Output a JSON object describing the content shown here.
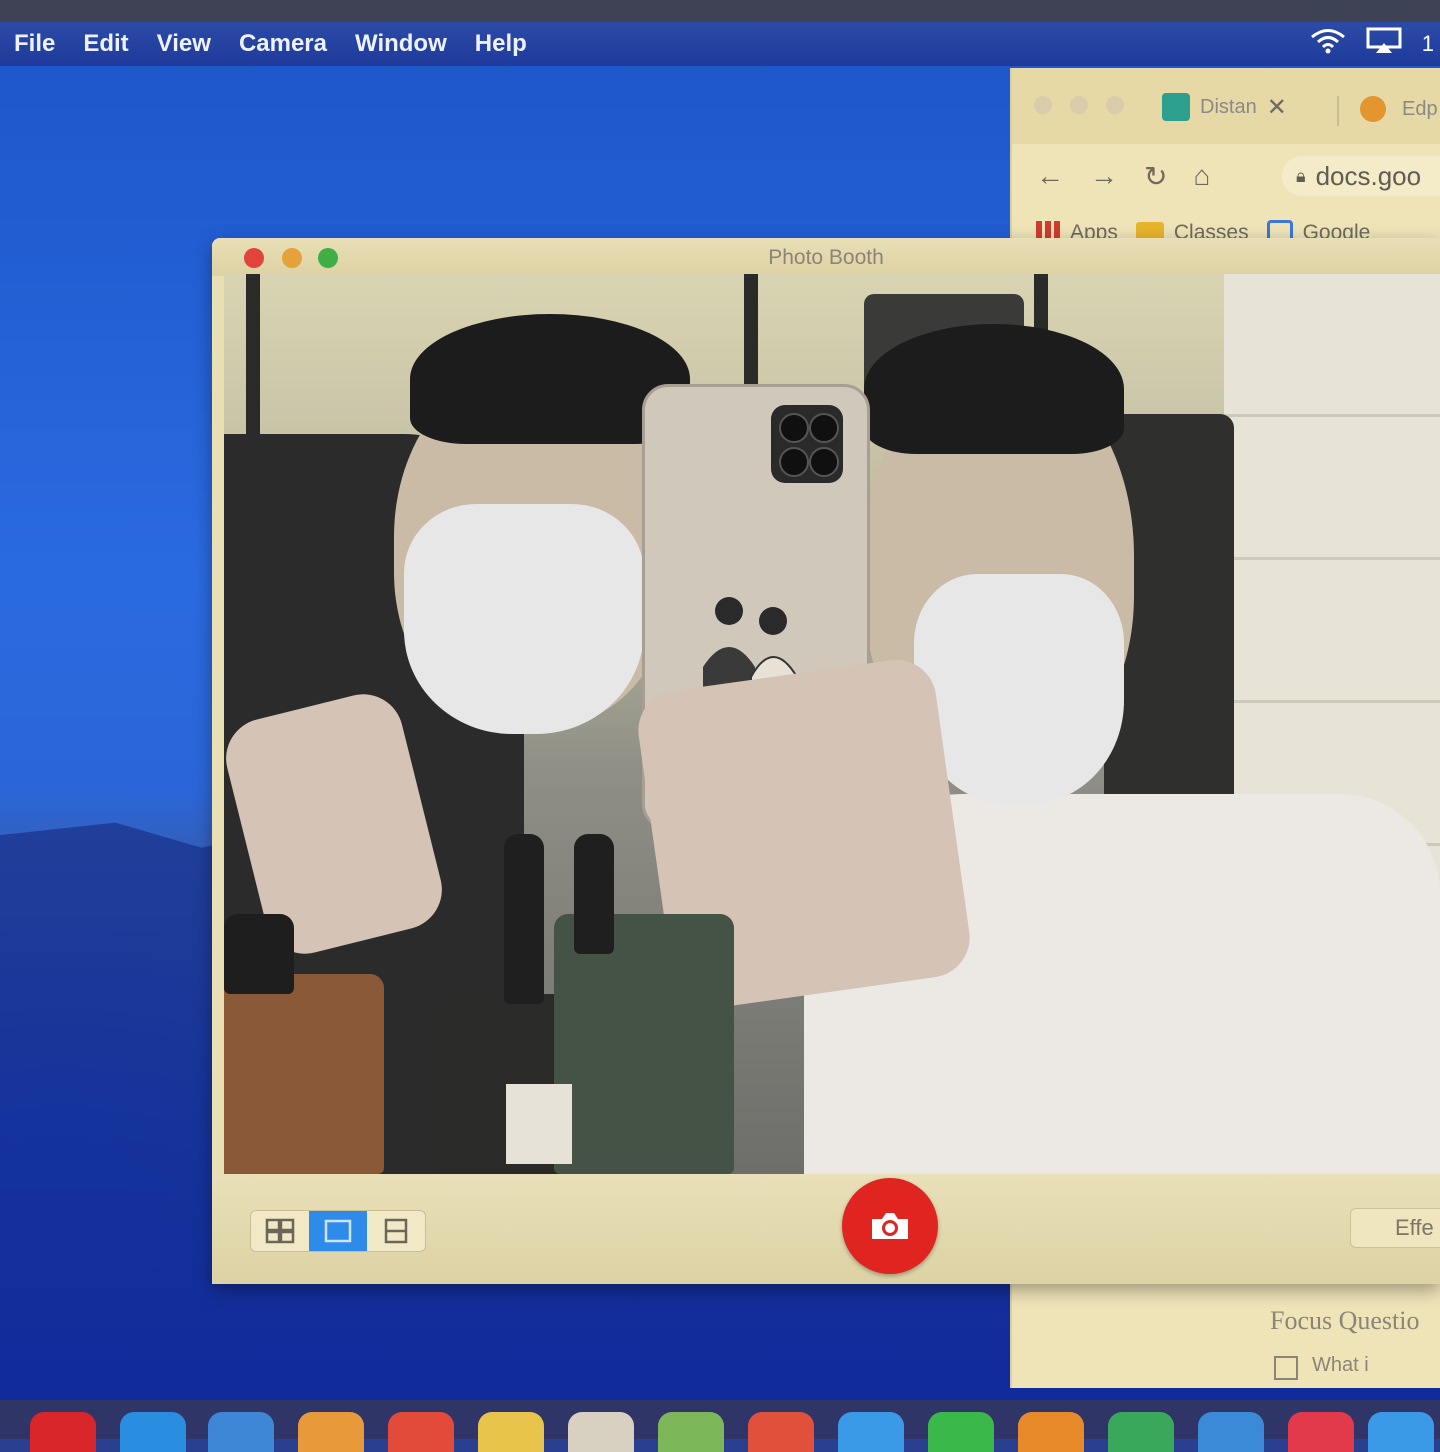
{
  "menubar": {
    "items": [
      "File",
      "Edit",
      "View",
      "Camera",
      "Window",
      "Help"
    ],
    "right_clock": "1"
  },
  "browser": {
    "tab1_title": "Distan",
    "tab1_close": "✕",
    "tab2_title": "Edp",
    "url": "docs.goo",
    "bookmarks": [
      "Apps",
      "Classes",
      "Google"
    ],
    "doc_heading": "Focus Questio",
    "doc_line": "What i"
  },
  "photobooth": {
    "title": "Photo Booth",
    "effects_label": "Effe",
    "view_modes": [
      "grid-view",
      "single-view",
      "filmstrip-view"
    ],
    "selected_view": "single-view"
  },
  "colors": {
    "close": "#e0443a",
    "minimize": "#e6a23a",
    "zoom": "#3fae44",
    "shutter": "#e0241f",
    "selected_segment": "#2f8bea"
  },
  "dock": {
    "icons": [
      "opera-icon",
      "safari-icon",
      "finder-icon",
      "photos-icon",
      "calendar-icon",
      "notes-icon",
      "reminders-icon",
      "maps-icon",
      "chrome-icon",
      "mail-icon",
      "facetime-icon",
      "keynote-icon",
      "numbers-icon",
      "preview-icon",
      "music-icon",
      "appstore-icon"
    ]
  }
}
